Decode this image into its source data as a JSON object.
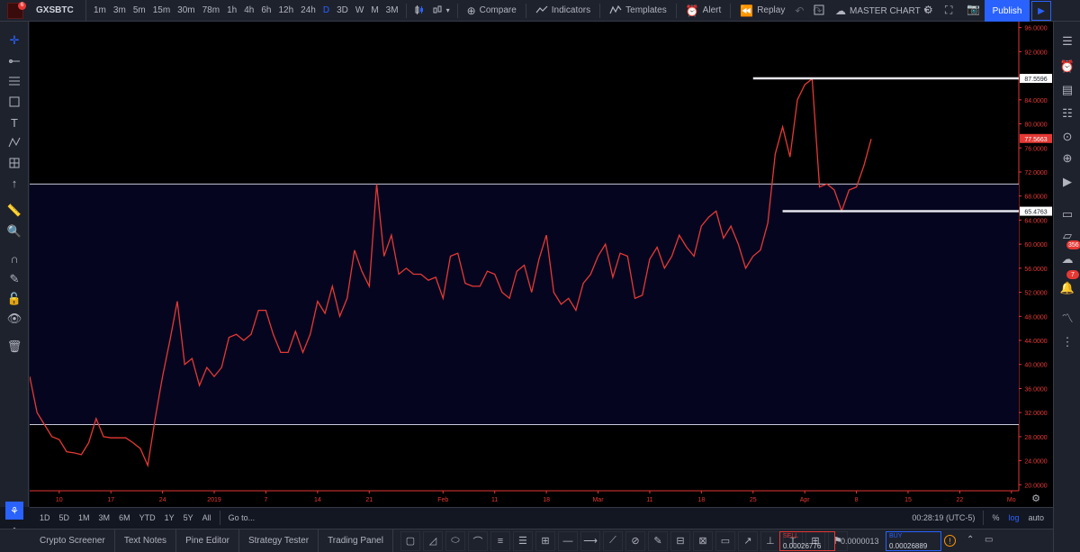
{
  "header": {
    "symbol": "GXSBTC",
    "notification_count": "6",
    "timeframes": [
      "1m",
      "3m",
      "5m",
      "15m",
      "30m",
      "78m",
      "1h",
      "4h",
      "6h",
      "12h",
      "24h",
      "D",
      "3D",
      "W",
      "M",
      "3M"
    ],
    "active_timeframe": "D",
    "compare_label": "Compare",
    "indicators_label": "Indicators",
    "templates_label": "Templates",
    "alert_label": "Alert",
    "replay_label": "Replay",
    "layout_label": "MASTER CHART",
    "publish_label": "Publish"
  },
  "right_sidebar": {
    "badge_notifications": "356",
    "badge_alerts": "7"
  },
  "chart_data": {
    "type": "line",
    "series_color": "#e53935",
    "y_ticks": [
      "96.0000",
      "92.0000",
      "88.0000",
      "84.0000",
      "80.0000",
      "76.0000",
      "72.0000",
      "68.0000",
      "64.0000",
      "60.0000",
      "56.0000",
      "52.0000",
      "48.0000",
      "44.0000",
      "40.0000",
      "36.0000",
      "32.0000",
      "28.0000",
      "24.0000",
      "20.0000"
    ],
    "y_tick_values": [
      96,
      92,
      88,
      84,
      80,
      76,
      72,
      68,
      64,
      60,
      56,
      52,
      48,
      44,
      40,
      36,
      32,
      28,
      24,
      20
    ],
    "x_ticks": [
      "10",
      "17",
      "24",
      "2019",
      "7",
      "14",
      "21",
      "Feb",
      "11",
      "18",
      "Mar",
      "11",
      "18",
      "25",
      "Apr",
      "8",
      "15",
      "22",
      "Mo"
    ],
    "x_tick_index": [
      4,
      11,
      18,
      25,
      32,
      39,
      46,
      56,
      63,
      70,
      77,
      84,
      91,
      98,
      105,
      112,
      119,
      126,
      133
    ],
    "ylim": [
      19,
      97
    ],
    "xlim": [
      0,
      134
    ],
    "values": [
      38,
      32,
      30,
      28,
      27.5,
      25.5,
      25.3,
      25,
      27,
      31,
      28,
      27.8,
      27.8,
      27.8,
      27,
      26,
      23.2,
      31,
      38,
      44,
      50.5,
      40,
      41,
      36.5,
      39.5,
      38,
      39.5,
      44.5,
      45,
      44,
      45,
      49,
      49,
      45,
      42,
      42,
      45.5,
      42,
      45,
      50.5,
      48.5,
      53,
      48,
      51,
      59,
      55.5,
      53,
      70,
      58,
      61.5,
      55,
      56,
      55,
      55,
      54,
      54.5,
      51,
      58,
      58.5,
      53.5,
      53,
      53,
      55.5,
      55,
      52,
      51,
      55.5,
      56.5,
      52,
      57.5,
      61.5,
      52,
      50,
      51,
      49,
      53.5,
      55,
      58,
      60,
      54.5,
      58.5,
      58,
      51,
      51.5,
      57.5,
      59.5,
      56,
      58,
      61.5,
      59.5,
      58,
      63,
      64.5,
      65.5,
      61,
      63,
      60,
      56,
      58,
      59,
      63.5,
      75,
      79.5,
      74.5,
      84,
      86.5,
      87.5,
      69.5,
      70,
      69,
      65.5,
      69,
      69.5,
      73,
      77.5
    ],
    "zone": {
      "top": 70,
      "bottom": 30
    },
    "levels": [
      {
        "value": 87.5596,
        "label": "87.5596",
        "from_index": 98
      },
      {
        "value": 65.4763,
        "label": "65.4763",
        "from_index": 102
      }
    ],
    "last_price": {
      "value": 77.5663,
      "label": "77.5663"
    }
  },
  "range_bar": {
    "ranges": [
      "1D",
      "5D",
      "1M",
      "3M",
      "6M",
      "YTD",
      "1Y",
      "5Y",
      "All"
    ],
    "goto_label": "Go to...",
    "clock": "00:28:19 (UTC-5)",
    "percent_label": "%",
    "log_label": "log",
    "auto_label": "auto"
  },
  "bottom_bar": {
    "tabs": [
      "Crypto Screener",
      "Text Notes",
      "Pine Editor",
      "Strategy Tester",
      "Trading Panel"
    ],
    "sell_label": "SELL",
    "sell_price": "0.00026776",
    "spread": "0.0000013",
    "buy_label": "BUY",
    "buy_price": "0.00026889"
  }
}
